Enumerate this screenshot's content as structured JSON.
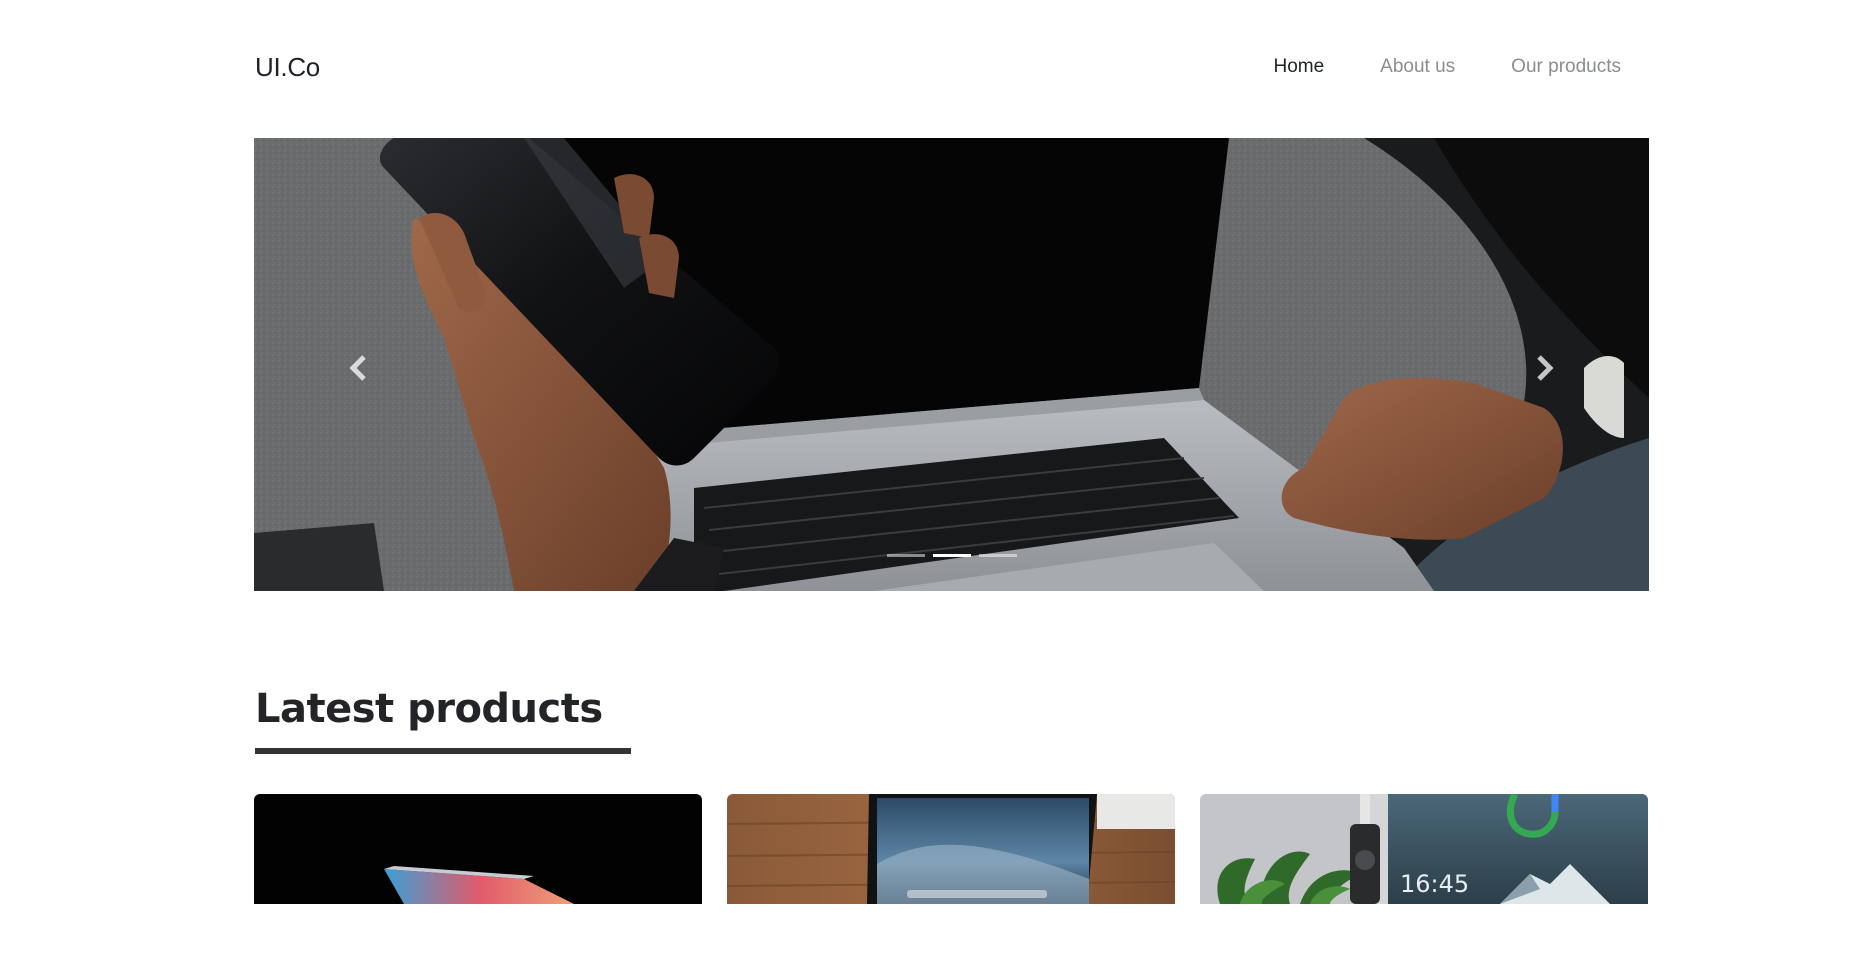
{
  "header": {
    "brand": "UI.Co",
    "nav": [
      {
        "label": "Home",
        "active": true
      },
      {
        "label": "About us",
        "active": false
      },
      {
        "label": "Our products",
        "active": false
      }
    ]
  },
  "hero": {
    "image": "person holding phone over laptop",
    "slide_count": 3,
    "active_slide": 2,
    "prev_icon": "chevron-left-icon",
    "next_icon": "chevron-right-icon"
  },
  "products": {
    "title": "Latest products",
    "cards": [
      {
        "image": "laptop on dark background"
      },
      {
        "image": "laptop on wooden desk"
      },
      {
        "image": "monitor with plant"
      }
    ]
  },
  "colors": {
    "text_dark": "#1f2229",
    "nav_inactive": "#8b8d90",
    "underline": "#333335"
  }
}
